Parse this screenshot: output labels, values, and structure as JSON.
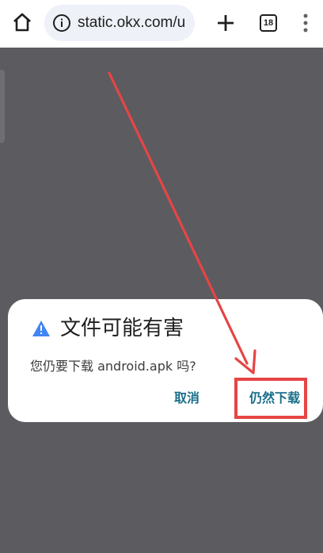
{
  "browser": {
    "url": "static.okx.com/u",
    "tab_count": "18"
  },
  "dialog": {
    "title": "文件可能有害",
    "message": "您仍要下载 android.apk 吗?",
    "cancel_label": "取消",
    "confirm_label": "仍然下载"
  },
  "colors": {
    "warning_icon": "#4285f4",
    "button_text": "#1a6e8a",
    "annotation": "#e64545",
    "backdrop": "#5c5b60"
  },
  "icons": {
    "home": "home-icon",
    "site_info": "info-icon",
    "new_tab": "plus-icon",
    "menu": "more-vert-icon",
    "warning": "warning-icon"
  }
}
